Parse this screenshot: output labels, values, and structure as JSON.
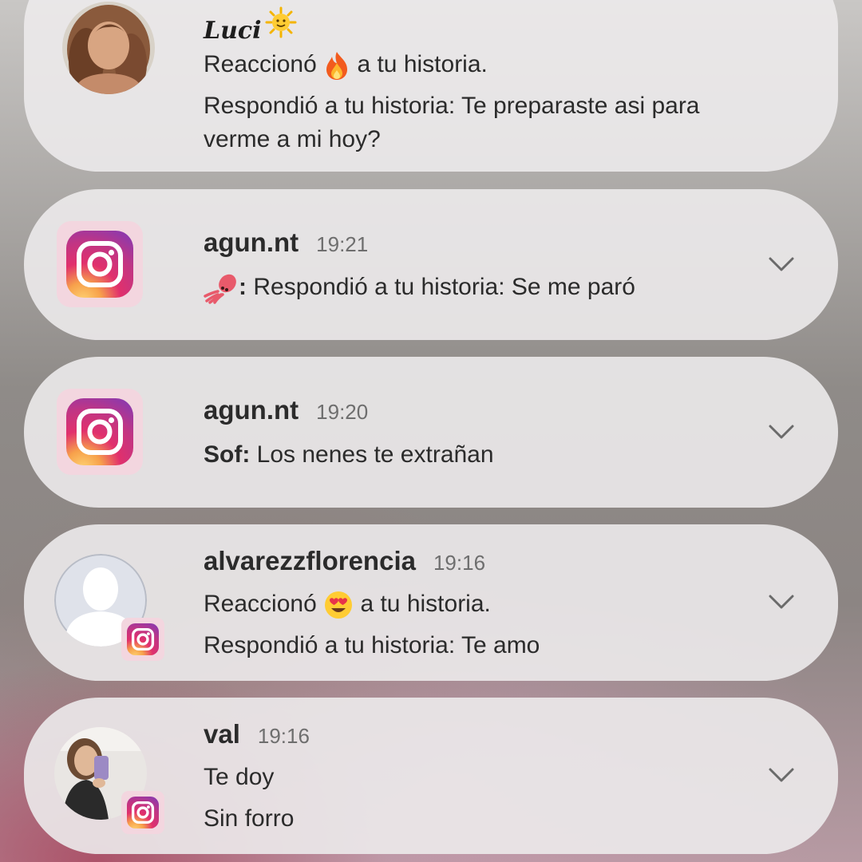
{
  "notifications": [
    {
      "name": "Luci",
      "name_emoji": "sun-face-emoji",
      "line1_before": "Reaccionó",
      "line1_emoji": "fire-emoji",
      "line1_after": "a tu historia.",
      "line2": "Respondió a tu historia: Te preparaste asi para verme a mi hoy?"
    },
    {
      "name": "agun.nt",
      "time": "19:21",
      "sender_emoji": "squid-emoji",
      "sender_suffix": ":",
      "message": "Respondió a tu historia: Se me paró",
      "icon": "instagram-icon"
    },
    {
      "name": "agun.nt",
      "time": "19:20",
      "sender": "Sof:",
      "message": "Los nenes te extrañan",
      "icon": "instagram-icon"
    },
    {
      "name": "alvarezzflorencia",
      "time": "19:16",
      "line1_before": "Reaccionó",
      "line1_emoji": "heart-eyes-emoji",
      "line1_after": "a tu historia.",
      "line2": "Respondió a tu historia: Te amo",
      "icon": "instagram-icon"
    },
    {
      "name": "val",
      "time": "19:16",
      "line1": "Te doy",
      "line2": "Sin forro",
      "icon": "instagram-icon"
    }
  ],
  "colors": {
    "card": "#ECEAEB",
    "text": "#2B2B2B",
    "time": "#6E6E6E",
    "tile": "#F3D6DF"
  }
}
